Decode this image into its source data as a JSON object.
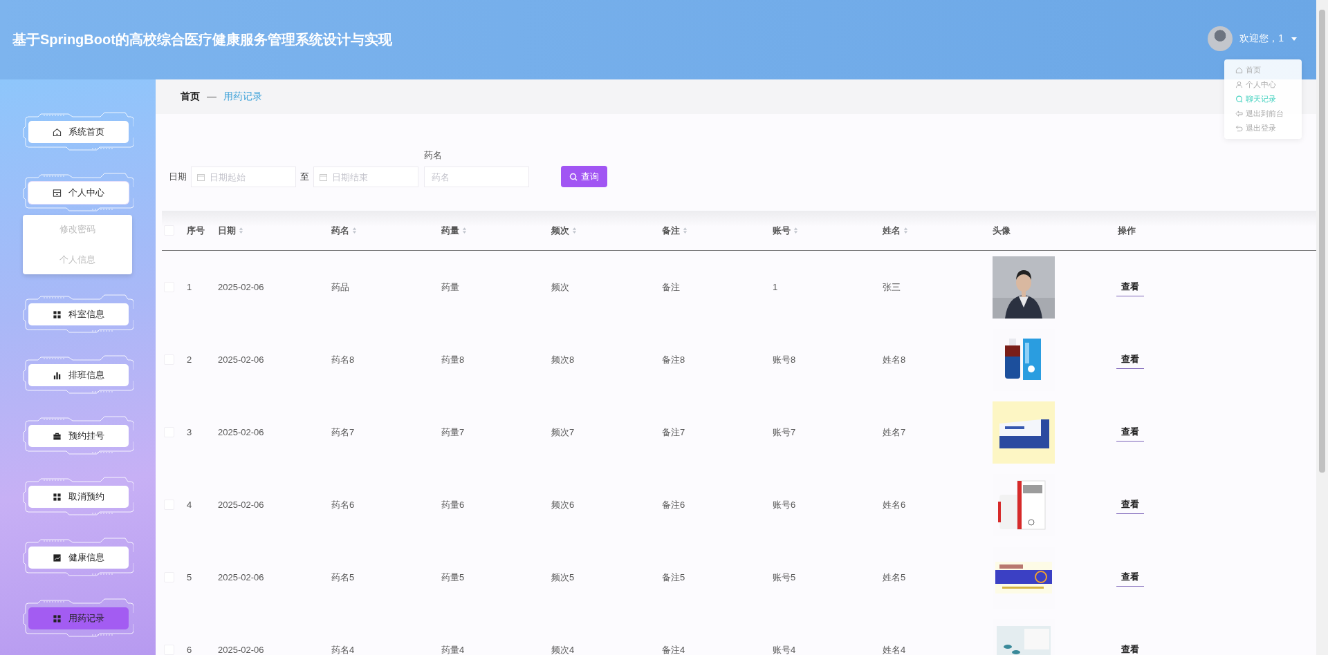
{
  "header": {
    "title": "基于SpringBoot的高校综合医疗健康服务管理系统设计与实现",
    "greeting": "欢迎您，1"
  },
  "user_menu": {
    "items": [
      {
        "label": "首页",
        "selected": false
      },
      {
        "label": "个人中心",
        "selected": false
      },
      {
        "label": "聊天记录",
        "selected": true
      },
      {
        "label": "退出到前台",
        "selected": false
      },
      {
        "label": "退出登录",
        "selected": false
      }
    ]
  },
  "sidebar": {
    "items": [
      {
        "label": "系统首页",
        "selected": false
      },
      {
        "label": "个人中心",
        "selected": false,
        "expanded": true,
        "children": [
          {
            "label": "修改密码"
          },
          {
            "label": "个人信息"
          }
        ]
      },
      {
        "label": "科室信息",
        "selected": false
      },
      {
        "label": "排班信息",
        "selected": false
      },
      {
        "label": "预约挂号",
        "selected": false
      },
      {
        "label": "取消预约",
        "selected": false
      },
      {
        "label": "健康信息",
        "selected": false
      },
      {
        "label": "用药记录",
        "selected": true
      }
    ]
  },
  "breadcrumb": [
    "首页",
    "用药记录"
  ],
  "search": {
    "date_label": "日期",
    "start_placeholder": "日期起始",
    "separator": "至",
    "end_placeholder": "日期结束",
    "name_label": "药名",
    "name_placeholder": "药名",
    "button": "查询"
  },
  "table": {
    "select_all": {
      "checked": false
    },
    "columns": [
      {
        "label": "序号",
        "sortable": false
      },
      {
        "label": "日期",
        "sortable": true
      },
      {
        "label": "药名",
        "sortable": true
      },
      {
        "label": "药量",
        "sortable": true
      },
      {
        "label": "频次",
        "sortable": true
      },
      {
        "label": "备注",
        "sortable": true
      },
      {
        "label": "账号",
        "sortable": true
      },
      {
        "label": "姓名",
        "sortable": true
      },
      {
        "label": "头像",
        "sortable": false
      },
      {
        "label": "操作",
        "sortable": false
      }
    ],
    "rows": [
      {
        "checked": false,
        "cells": [
          "1",
          "2025-02-06",
          "药品",
          "药量",
          "频次",
          "备注",
          "1",
          "张三"
        ],
        "action": "查看"
      },
      {
        "checked": false,
        "cells": [
          "2",
          "2025-02-06",
          "药名8",
          "药量8",
          "频次8",
          "备注8",
          "账号8",
          "姓名8"
        ],
        "action": "查看"
      },
      {
        "checked": false,
        "cells": [
          "3",
          "2025-02-06",
          "药名7",
          "药量7",
          "频次7",
          "备注7",
          "账号7",
          "姓名7"
        ],
        "action": "查看"
      },
      {
        "checked": false,
        "cells": [
          "4",
          "2025-02-06",
          "药名6",
          "药量6",
          "频次6",
          "备注6",
          "账号6",
          "姓名6"
        ],
        "action": "查看"
      },
      {
        "checked": false,
        "cells": [
          "5",
          "2025-02-06",
          "药名5",
          "药量5",
          "频次5",
          "备注5",
          "账号5",
          "姓名5"
        ],
        "action": "查看"
      },
      {
        "checked": false,
        "cells": [
          "6",
          "2025-02-06",
          "药名4",
          "药量4",
          "频次4",
          "备注4",
          "账号4",
          "姓名4"
        ],
        "action": "查看"
      }
    ]
  }
}
